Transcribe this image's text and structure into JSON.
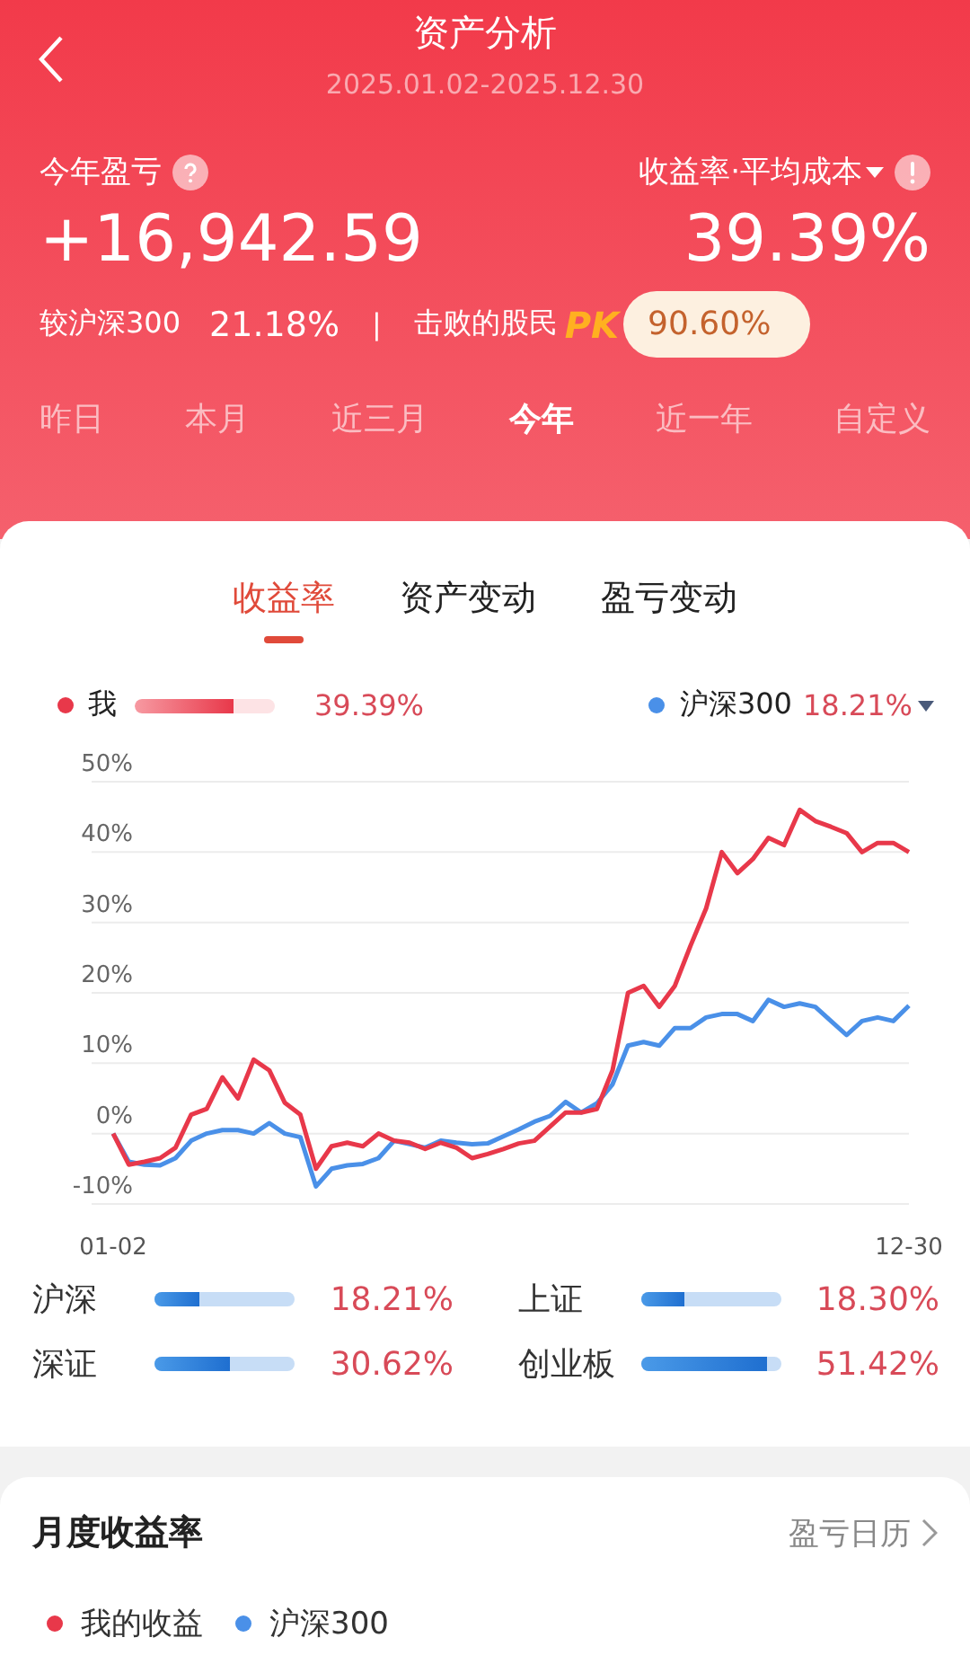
{
  "header": {
    "title": "资产分析",
    "date_range": "2025.01.02-2025.12.30"
  },
  "summary": {
    "label": "今年盈亏",
    "value": "+16,942.59",
    "metric_label": "收益率·平均成本",
    "metric_value": "39.39%",
    "compare_label": "较沪深300",
    "compare_value": "21.18%",
    "separator": "|",
    "beat_label": "击败的股民",
    "pk_badge": "PK",
    "beat_value": "90.60%"
  },
  "periods": [
    {
      "label": "昨日",
      "selected": false
    },
    {
      "label": "本月",
      "selected": false
    },
    {
      "label": "近三月",
      "selected": false
    },
    {
      "label": "今年",
      "selected": true
    },
    {
      "label": "近一年",
      "selected": false
    },
    {
      "label": "自定义",
      "selected": false
    }
  ],
  "chart_tabs": [
    {
      "label": "收益率",
      "selected": true
    },
    {
      "label": "资产变动",
      "selected": false
    },
    {
      "label": "盈亏变动",
      "selected": false
    }
  ],
  "legend": {
    "mine": {
      "level": 0.7,
      "value": "39.39%"
    },
    "benchmark": {
      "value": "18.21%"
    }
  },
  "chart_data": {
    "type": "line",
    "grid": true,
    "categories": [
      "01-02",
      null,
      null,
      null,
      null,
      null,
      null,
      null,
      null,
      null,
      null,
      null,
      null,
      null,
      null,
      null,
      null,
      null,
      null,
      null,
      null,
      null,
      null,
      null,
      null,
      null,
      null,
      null,
      null,
      null,
      null,
      null,
      null,
      null,
      null,
      null,
      null,
      null,
      null,
      null,
      null,
      null,
      null,
      null,
      null,
      null,
      null,
      null,
      null,
      null,
      null,
      "12-30"
    ],
    "series": [
      {
        "name": "我",
        "color": "#e8384a",
        "values": [
          0,
          -4.4,
          -4,
          -3.5,
          -2,
          2.7,
          3.5,
          8,
          5,
          10.5,
          9,
          4.4,
          2.7,
          -5,
          -1.8,
          -1.3,
          -1.8,
          0,
          -1,
          -1.3,
          -2.2,
          -1.3,
          -2,
          -3.5,
          -2.9,
          -2.2,
          -1.4,
          -1,
          1,
          3,
          3,
          3.5,
          9,
          20,
          21,
          18,
          21,
          26.7,
          32,
          40,
          37,
          39,
          42,
          41,
          46,
          44.4,
          43.6,
          42.7,
          40,
          41.3,
          41.3,
          40
        ]
      },
      {
        "name": "沪深300",
        "color": "#4a90e8",
        "values": [
          0,
          -4,
          -4.4,
          -4.5,
          -3.5,
          -1,
          0,
          0.5,
          0.5,
          0,
          1.5,
          0,
          -0.5,
          -7.5,
          -5,
          -4.5,
          -4.3,
          -3.5,
          -1,
          -1.5,
          -2,
          -1,
          -1.3,
          -1.5,
          -1.4,
          -0.4,
          0.6,
          1.7,
          2.5,
          4.5,
          3,
          4.3,
          7,
          12.5,
          13,
          12.5,
          15,
          15,
          16.5,
          17,
          17,
          16,
          19,
          18,
          18.5,
          18,
          16,
          14,
          16,
          16.5,
          16,
          18.2
        ]
      }
    ],
    "ylim": [
      -10,
      50
    ],
    "yticks": [
      {
        "value": -10,
        "label": "-10%"
      },
      {
        "value": 0,
        "label": "0%"
      },
      {
        "value": 10,
        "label": "10%"
      },
      {
        "value": 20,
        "label": "20%"
      },
      {
        "value": 30,
        "label": "30%"
      },
      {
        "value": 40,
        "label": "40%"
      },
      {
        "value": 50,
        "label": "50%"
      }
    ]
  },
  "indices": [
    {
      "name": "沪深",
      "level": 0.32,
      "value": "18.21%"
    },
    {
      "name": "上证",
      "level": 0.32,
      "value": "18.30%"
    },
    {
      "name": "深证",
      "level": 0.54,
      "value": "30.62%"
    },
    {
      "name": "创业板",
      "level": 0.91,
      "value": "51.42%"
    }
  ],
  "monthly": {
    "title": "月度收益率",
    "link": "盈亏日历",
    "legend": [
      "我的收益",
      "沪深300"
    ]
  }
}
